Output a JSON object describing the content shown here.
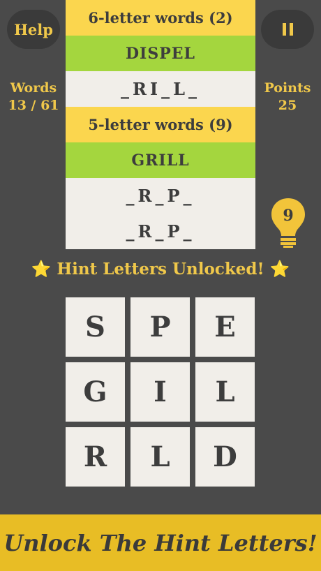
{
  "top_bar": {
    "help_label": "Help",
    "pause_icon": "pause-icon"
  },
  "stats": {
    "words_label": "Words",
    "words_value": "13 / 61",
    "points_label": "Points",
    "points_value": "25"
  },
  "word_list": {
    "six_header": "6-letter words (2)",
    "six_solved": "DISPEL",
    "six_blank": "_RI_L_",
    "five_header": "5-letter words (9)",
    "five_solved": "GRILL",
    "five_blank_1": "_R_P_",
    "five_blank_2": "_R_P_"
  },
  "hint": {
    "count": "9",
    "message": "Hint Letters Unlocked!",
    "icon": "lightbulb-icon"
  },
  "grid": {
    "tiles": [
      "S",
      "P",
      "E",
      "G",
      "I",
      "L",
      "R",
      "L",
      "D"
    ]
  },
  "banner": {
    "text": "Unlock The Hint Letters!"
  },
  "colors": {
    "background": "#4a4a4a",
    "accent_yellow": "#fbd64e",
    "solved_green": "#a4d63e",
    "tile": "#f1eee9",
    "banner": "#e8bd25"
  }
}
